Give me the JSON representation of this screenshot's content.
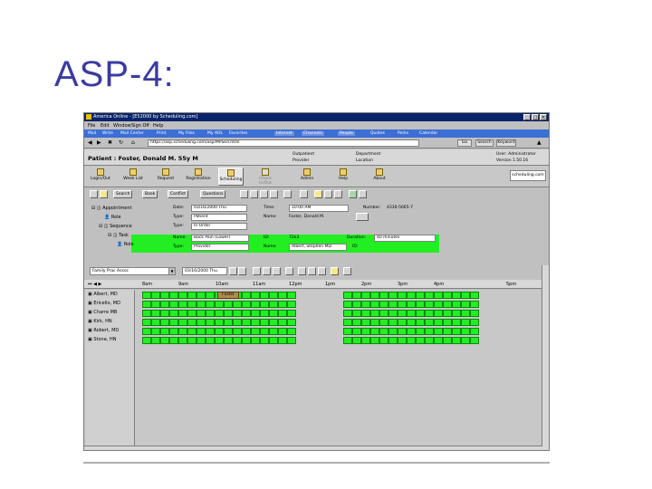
{
  "slide": {
    "title": "ASP-4:"
  },
  "window": {
    "title": "America Online - [E52000 by Scheduling.com]"
  },
  "menu": [
    "Mail",
    "Write",
    "Mail Center",
    "Print",
    "My Files",
    "My AOL",
    "Favorites",
    "Internet",
    "Channels",
    "People",
    "Quotes",
    "Perks",
    "Calendar"
  ],
  "menu2": [
    "File",
    "Edit",
    "Window",
    "Sign Off",
    "Help"
  ],
  "address": {
    "url": "https://asp.scheduling.com/asp/MPSkd.html",
    "go": "Go",
    "search": "Search",
    "keyword": "Keyword"
  },
  "patient": {
    "name": "Patient : Foster, Donald M. 55y M",
    "opt1": "Outpatient",
    "opt2": "Provider",
    "opt3": "Department",
    "opt4": "Location",
    "user": "User: Administrator",
    "version": "Version 1.50.16"
  },
  "toolbar2": [
    "Login/Out",
    "Week List",
    "Request",
    "Registration",
    "Scheduling",
    "Check In/Out",
    "Admin",
    "Help",
    "About"
  ],
  "logo": "scheduling.com",
  "toolbar3": [
    "Search",
    "Book",
    "Conflict",
    "Questions"
  ],
  "detail": {
    "appt": "Appointment",
    "role": "Role",
    "sequence": "Sequence",
    "task": "Task",
    "role2": "Role",
    "date_l": "Date:",
    "date_v": "03/16/2000 Thu",
    "time_l": "Time:",
    "time_v": "10:00 AM",
    "number_l": "Number:",
    "number_v": "4330-5665-7",
    "type_l": "Type:",
    "type_v": "Patient",
    "name_l": "Name:",
    "name_v": "Foster, Donald M.",
    "type2_l": "Type:",
    "type2_v": "In Order",
    "name2_l": "Name:",
    "name2_v": "Back Pain (Lower)",
    "id_l": "ID:",
    "id_v": "72k3",
    "dur_l": "Duration:",
    "dur_v": "40 minutes",
    "type3_l": "Type:",
    "type3_v": "Provider",
    "name3_l": "Name:",
    "name3_v": "Albert, Stephen MD",
    "id2_l": "ID:"
  },
  "sched": {
    "group": "Family Prac Assoc",
    "date": "03/16/2000 Thu"
  },
  "times": [
    "8am",
    "9am",
    "10am",
    "11am",
    "12pm",
    "1pm",
    "2pm",
    "3pm",
    "4pm",
    "5pm"
  ],
  "providers": [
    "Albert, MD",
    "Ericello, MD",
    "Charre MB",
    "Kirk, HN",
    "Robert, MD",
    "Stone, HN"
  ],
  "booked_label": "Foster"
}
